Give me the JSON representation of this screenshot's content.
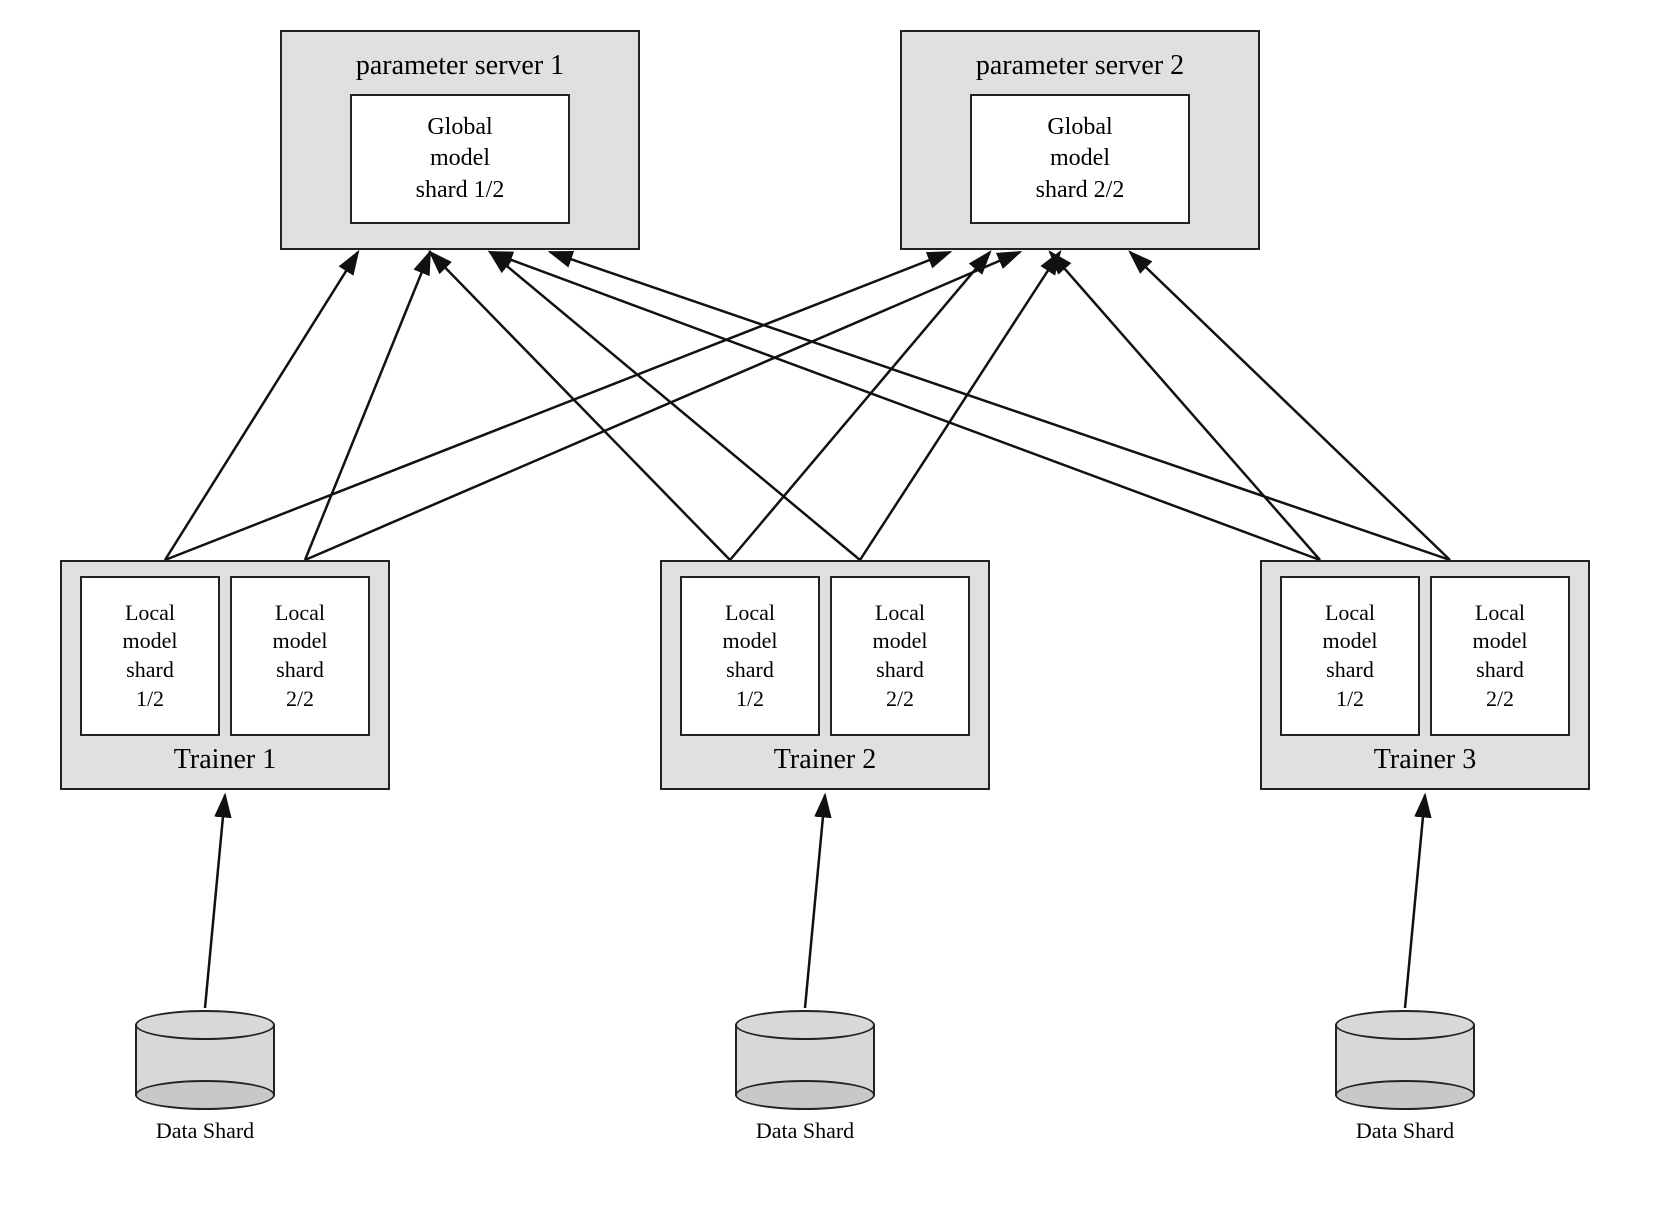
{
  "paramServer1": {
    "title": "parameter server 1",
    "shard": "Global\nmodel\nshard 1/2"
  },
  "paramServer2": {
    "title": "parameter server 2",
    "shard": "Global\nmodel\nshard 2/2"
  },
  "trainers": [
    {
      "title": "Trainer 1",
      "shard1": "Local\nmodel\nshard\n1/2",
      "shard2": "Local\nmodel\nshard\n2/2"
    },
    {
      "title": "Trainer 2",
      "shard1": "Local\nmodel\nshard\n1/2",
      "shard2": "Local\nmodel\nshard\n2/2"
    },
    {
      "title": "Trainer 3",
      "shard1": "Local\nmodel\nshard\n1/2",
      "shard2": "Local\nmodel\nshard\n2/2"
    }
  ],
  "dataShards": [
    "Data Shard",
    "Data Shard",
    "Data Shard"
  ]
}
